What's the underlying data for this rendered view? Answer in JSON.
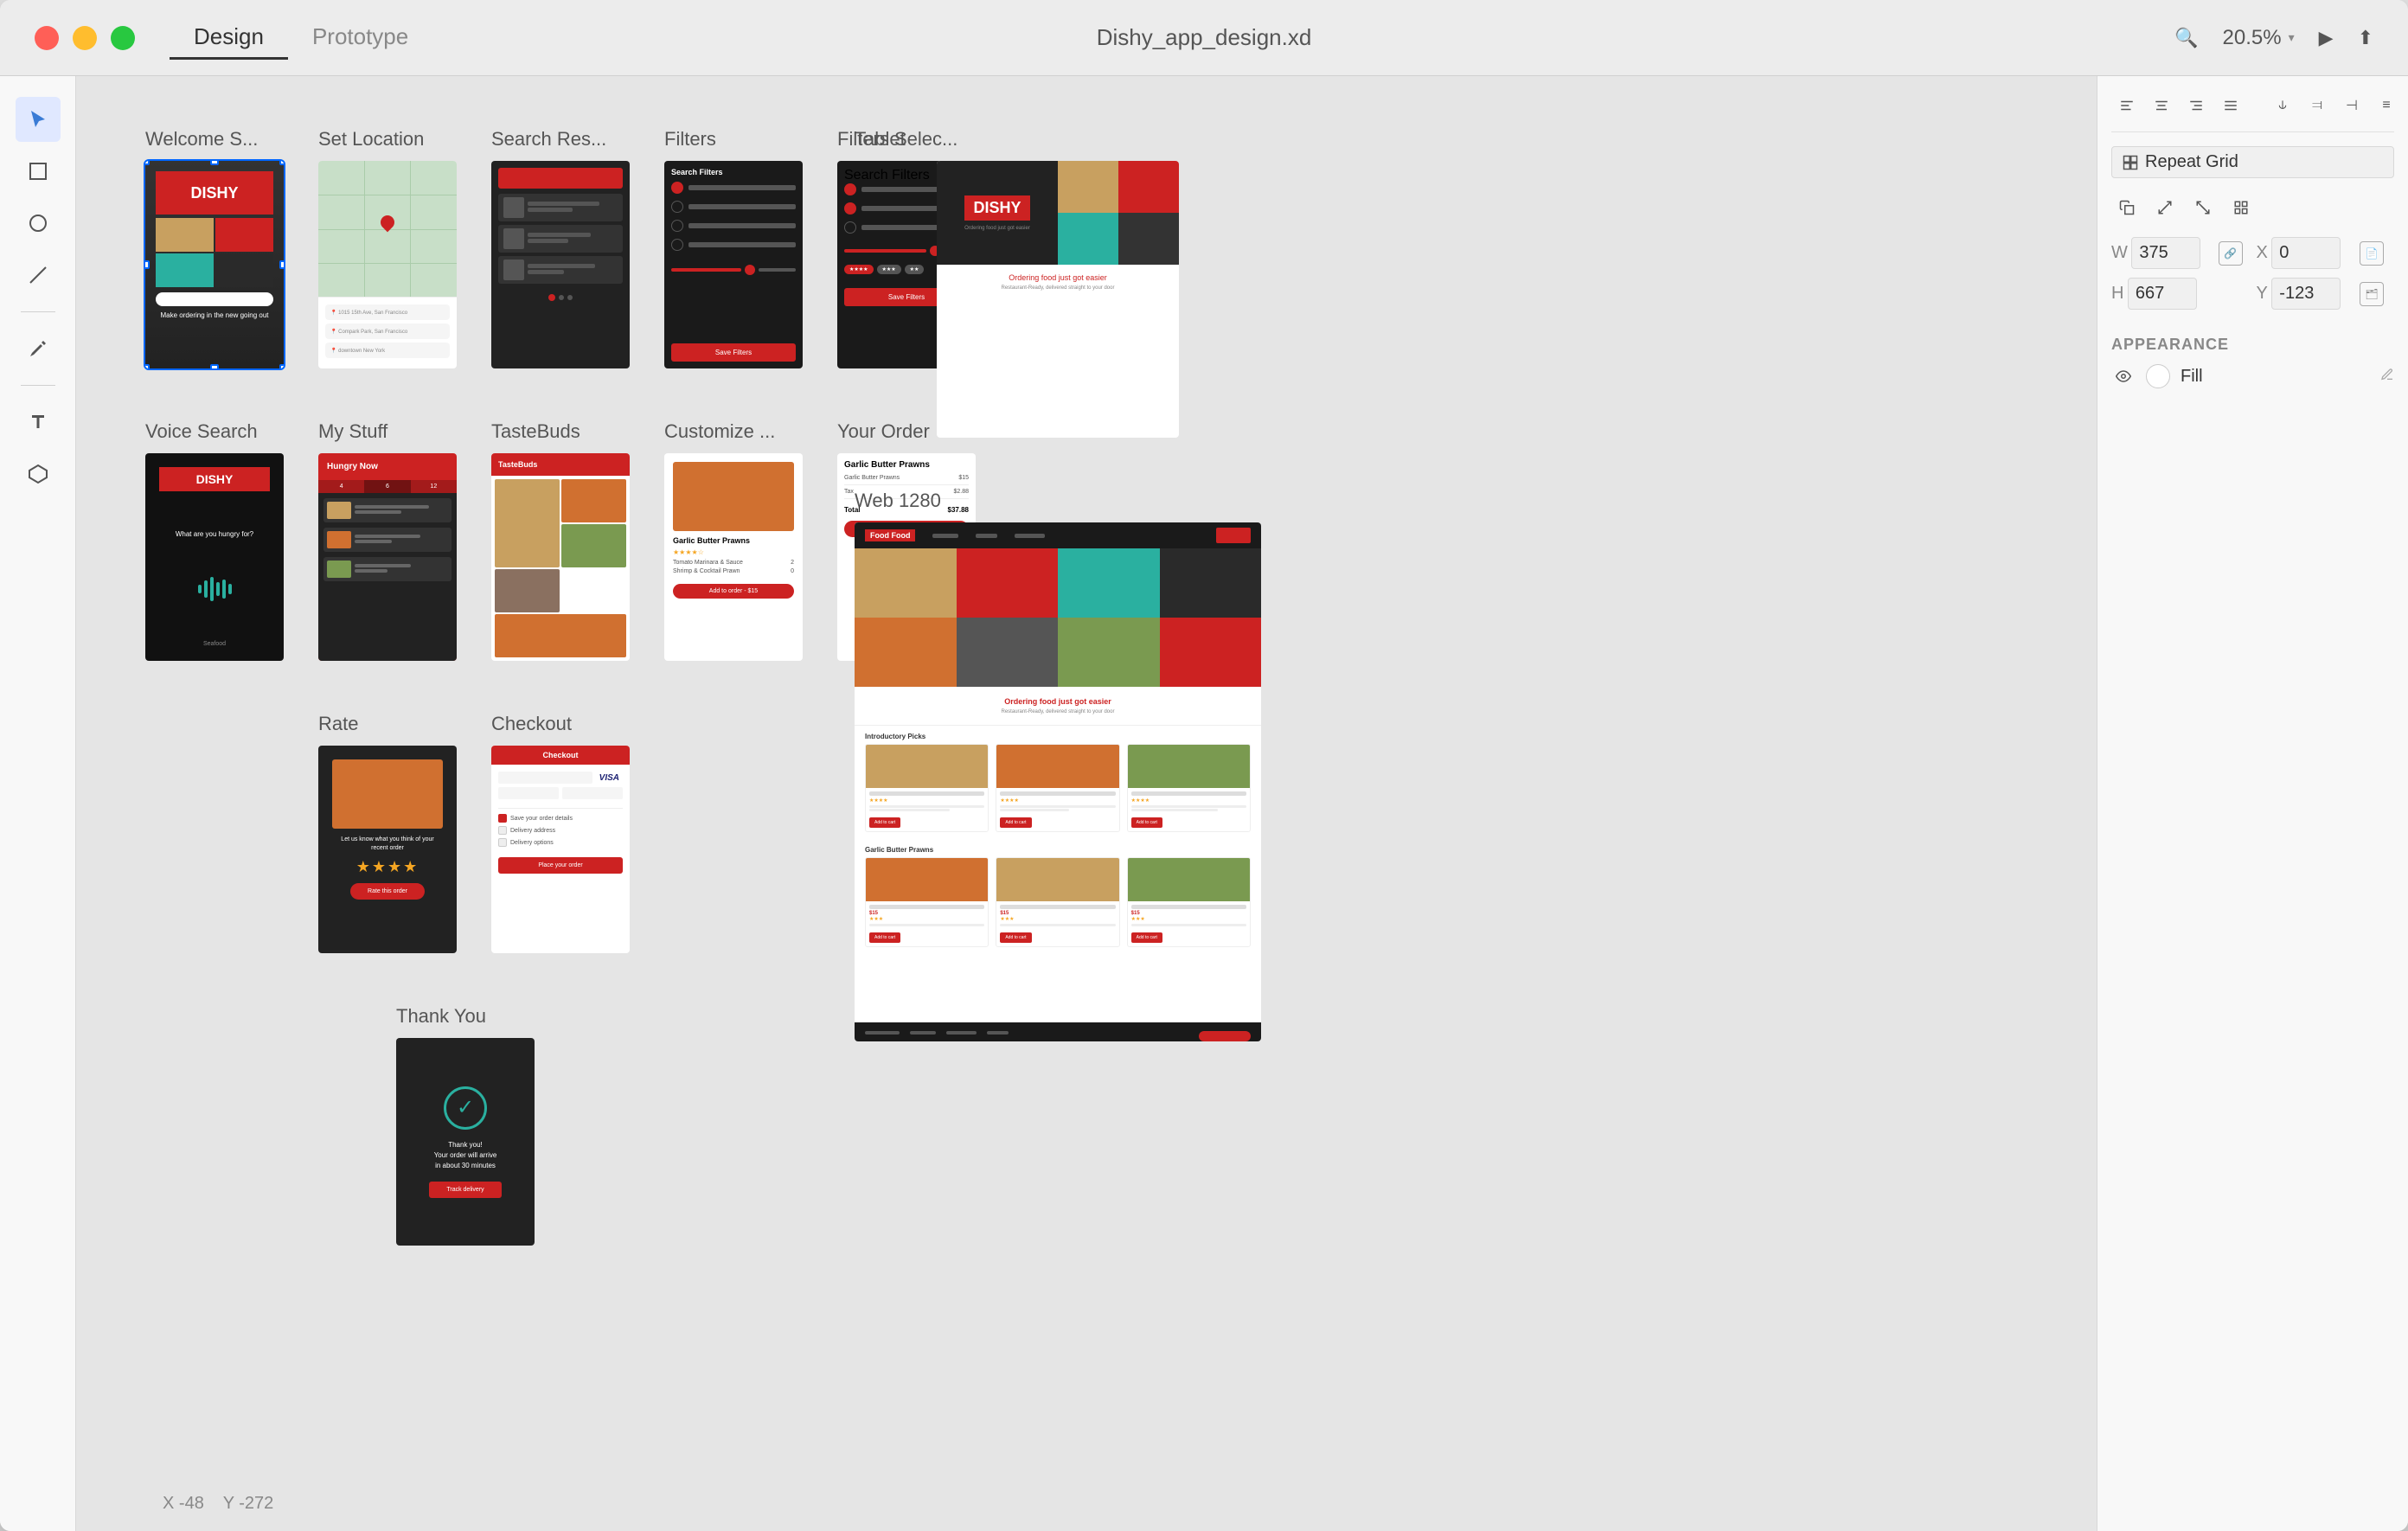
{
  "window": {
    "title": "Dishy_app_design.xd",
    "tabs": [
      {
        "label": "Design",
        "active": true
      },
      {
        "label": "Prototype",
        "active": false
      }
    ]
  },
  "titlebar": {
    "zoom_level": "20.5%",
    "zoom_chevron": "▾"
  },
  "toolbar": {
    "tools": [
      {
        "name": "select",
        "icon": "▶",
        "active": true
      },
      {
        "name": "rectangle",
        "icon": "□"
      },
      {
        "name": "circle",
        "icon": "○"
      },
      {
        "name": "line",
        "icon": "/"
      },
      {
        "name": "pen",
        "icon": "✒"
      },
      {
        "name": "text",
        "icon": "T"
      },
      {
        "name": "component",
        "icon": "⬡"
      }
    ]
  },
  "artboards": {
    "row1": [
      {
        "label": "Welcome S...",
        "type": "welcome",
        "selected": true
      },
      {
        "label": "Set Location",
        "type": "location"
      },
      {
        "label": "Search Res...",
        "type": "search"
      },
      {
        "label": "Filters",
        "type": "filters"
      },
      {
        "label": "Filters Selec...",
        "type": "filters-select"
      }
    ],
    "row2": [
      {
        "label": "Voice Search",
        "type": "voice"
      },
      {
        "label": "My Stuff",
        "type": "mystuff"
      },
      {
        "label": "TasteBuds",
        "type": "tastebuds"
      },
      {
        "label": "Customize ...",
        "type": "customize"
      },
      {
        "label": "Your Order",
        "type": "order"
      }
    ],
    "row3": [
      {
        "label": "Rate",
        "type": "rate"
      },
      {
        "label": "Checkout",
        "type": "checkout"
      }
    ],
    "row4": [
      {
        "label": "Thank You",
        "type": "thankyou"
      }
    ],
    "large": [
      {
        "label": "Tablet",
        "type": "tablet"
      },
      {
        "label": "Web 1280",
        "type": "web"
      }
    ]
  },
  "right_panel": {
    "repeat_grid_label": "Repeat Grid",
    "dimensions": {
      "w_label": "W",
      "w_value": "375",
      "h_label": "H",
      "h_value": "667",
      "x_label": "X",
      "x_value": "0",
      "y_label": "Y",
      "y_value": "-123"
    },
    "appearance": {
      "label": "APPEARANCE",
      "fill_label": "Fill"
    }
  },
  "coordinates": {
    "x_label": "X",
    "x_value": "-48",
    "y_label": "Y",
    "y_value": "-272"
  }
}
